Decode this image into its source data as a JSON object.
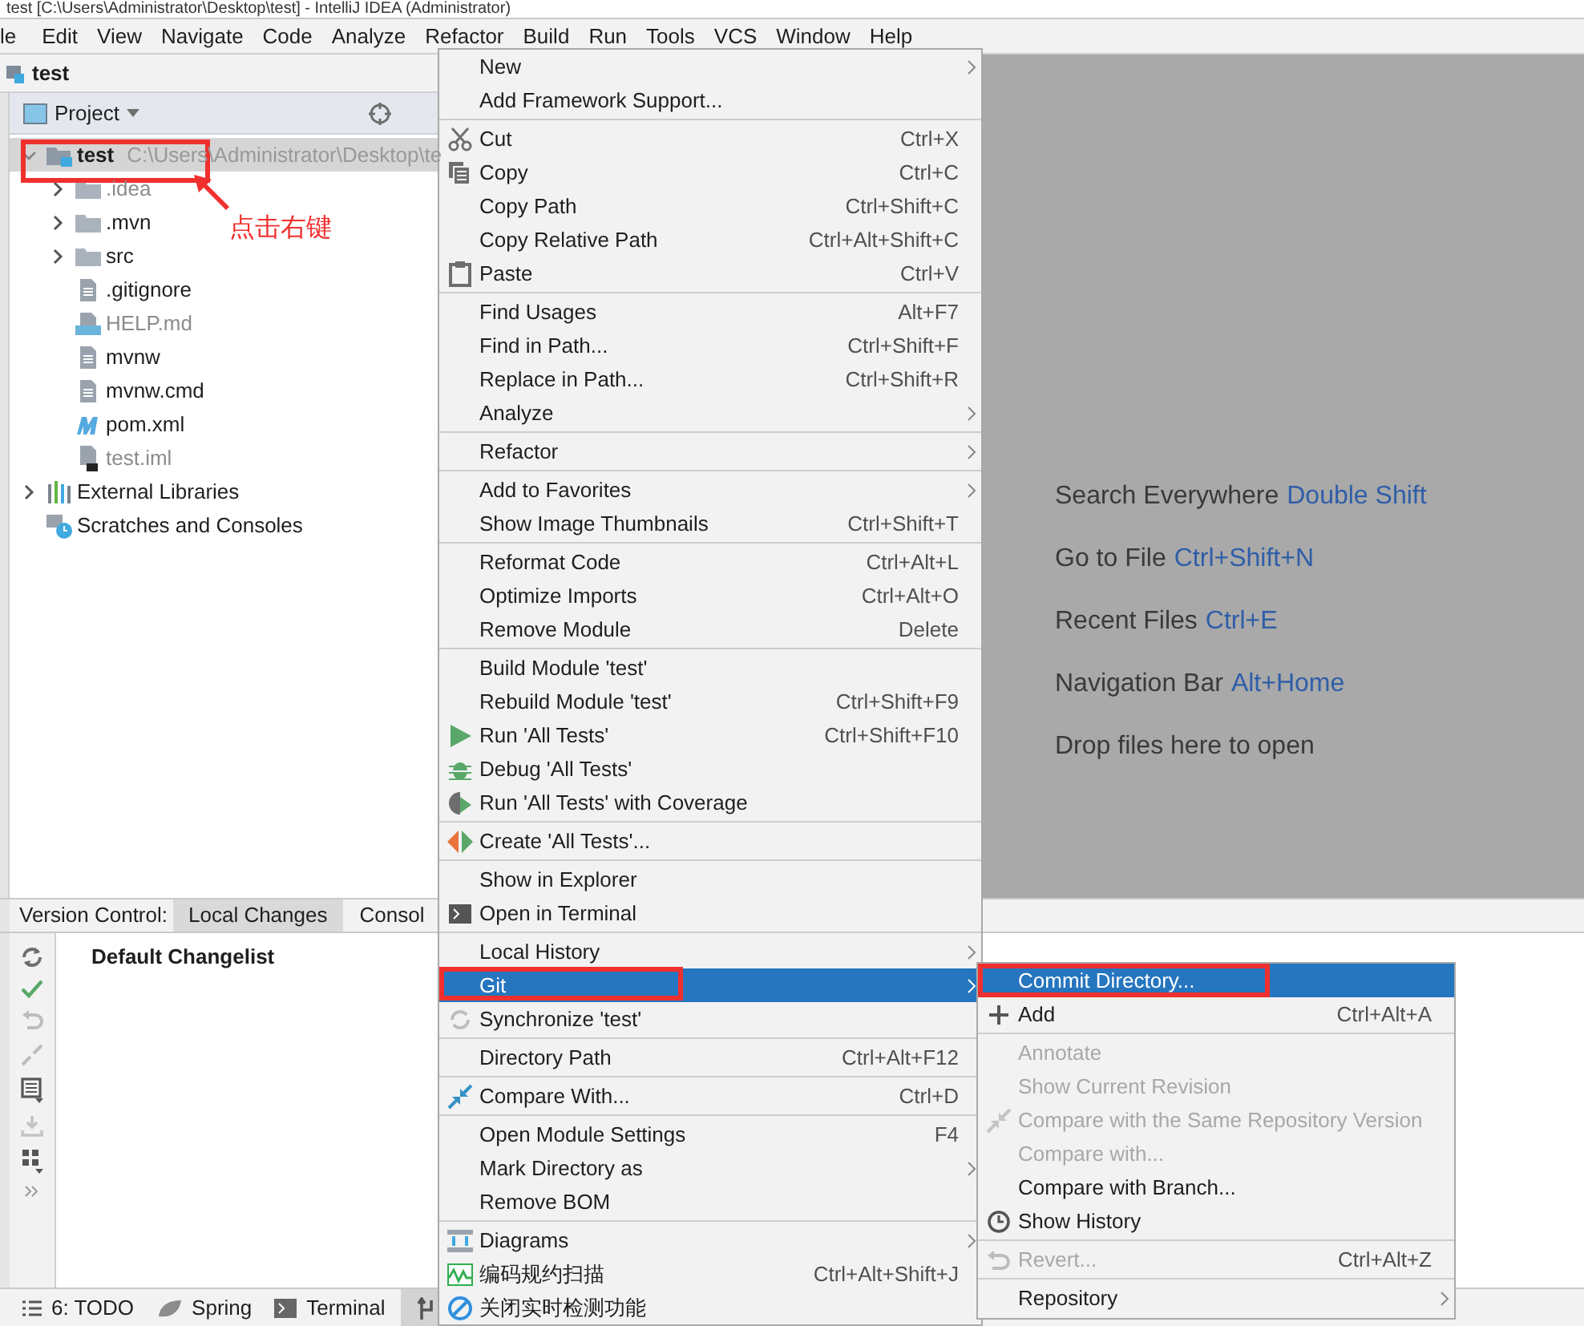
{
  "window": {
    "title": "test [C:\\Users\\Administrator\\Desktop\\test] - IntelliJ IDEA (Administrator)"
  },
  "menu_bar": [
    "le",
    "Edit",
    "View",
    "Navigate",
    "Code",
    "Analyze",
    "Refactor",
    "Build",
    "Run",
    "Tools",
    "VCS",
    "Window",
    "Help"
  ],
  "nav_bar": {
    "label": "test"
  },
  "project_panel": {
    "title": "Project",
    "tree": [
      {
        "label": "test",
        "path": "C:\\Users\\Administrator\\Desktop\\te",
        "kind": "module",
        "expanded": true,
        "selected": true,
        "children": [
          {
            "label": ".idea",
            "kind": "folder",
            "expanded": false,
            "selected": false,
            "ignored": true
          },
          {
            "label": ".mvn",
            "kind": "folder",
            "expanded": false,
            "selected": false,
            "ignored": false
          },
          {
            "label": "src",
            "kind": "folder",
            "expanded": false,
            "selected": false,
            "ignored": false
          },
          {
            "label": ".gitignore",
            "kind": "file",
            "selected": false,
            "ignored": false
          },
          {
            "label": "HELP.md",
            "kind": "markdown",
            "selected": false,
            "ignored": true
          },
          {
            "label": "mvnw",
            "kind": "file",
            "selected": false,
            "ignored": false
          },
          {
            "label": "mvnw.cmd",
            "kind": "file",
            "selected": false,
            "ignored": false
          },
          {
            "label": "pom.xml",
            "kind": "maven",
            "selected": false,
            "ignored": false
          },
          {
            "label": "test.iml",
            "kind": "iml",
            "selected": false,
            "ignored": true
          }
        ]
      },
      {
        "label": "External Libraries",
        "kind": "libraries",
        "expanded": false,
        "selected": false
      },
      {
        "label": "Scratches and Consoles",
        "kind": "scratches",
        "selected": false
      }
    ]
  },
  "editor_hints": [
    {
      "text": "Search Everywhere",
      "shortcut": "Double Shift"
    },
    {
      "text": "Go to File",
      "shortcut": "Ctrl+Shift+N"
    },
    {
      "text": "Recent Files",
      "shortcut": "Ctrl+E"
    },
    {
      "text": "Navigation Bar",
      "shortcut": "Alt+Home"
    },
    {
      "text": "Drop files here to open"
    }
  ],
  "version_control": {
    "label": "Version Control:",
    "tabs": [
      {
        "label": "Local Changes",
        "selected": true
      },
      {
        "label": "Consol",
        "selected": false
      }
    ],
    "changelist": "Default Changelist"
  },
  "status_bar": {
    "tabs": [
      {
        "label": "6: TODO",
        "kind": "todo",
        "selected": false
      },
      {
        "label": "Spring",
        "kind": "spring",
        "selected": false
      },
      {
        "label": "Terminal",
        "kind": "terminal",
        "selected": false
      },
      {
        "kind": "vcs",
        "selected": true
      }
    ]
  },
  "context_menu": {
    "groups": [
      [
        {
          "label": "New",
          "submenu": true,
          "selected": false
        },
        {
          "label": "Add Framework Support...",
          "selected": false
        }
      ],
      [
        {
          "label": "Cut",
          "kind": "cut",
          "shortcut": "Ctrl+X",
          "selected": false
        },
        {
          "label": "Copy",
          "kind": "copy",
          "shortcut": "Ctrl+C",
          "selected": false
        },
        {
          "label": "Copy Path",
          "shortcut": "Ctrl+Shift+C",
          "selected": false
        },
        {
          "label": "Copy Relative Path",
          "shortcut": "Ctrl+Alt+Shift+C",
          "selected": false
        },
        {
          "label": "Paste",
          "kind": "paste",
          "shortcut": "Ctrl+V",
          "selected": false
        }
      ],
      [
        {
          "label": "Find Usages",
          "shortcut": "Alt+F7",
          "selected": false
        },
        {
          "label": "Find in Path...",
          "shortcut": "Ctrl+Shift+F",
          "selected": false
        },
        {
          "label": "Replace in Path...",
          "shortcut": "Ctrl+Shift+R",
          "selected": false
        },
        {
          "label": "Analyze",
          "submenu": true,
          "selected": false
        }
      ],
      [
        {
          "label": "Refactor",
          "submenu": true,
          "selected": false
        }
      ],
      [
        {
          "label": "Add to Favorites",
          "submenu": true,
          "selected": false
        },
        {
          "label": "Show Image Thumbnails",
          "shortcut": "Ctrl+Shift+T",
          "selected": false
        }
      ],
      [
        {
          "label": "Reformat Code",
          "shortcut": "Ctrl+Alt+L",
          "selected": false
        },
        {
          "label": "Optimize Imports",
          "shortcut": "Ctrl+Alt+O",
          "selected": false
        },
        {
          "label": "Remove Module",
          "shortcut": "Delete",
          "selected": false
        }
      ],
      [
        {
          "label": "Build Module 'test'",
          "selected": false
        },
        {
          "label": "Rebuild Module 'test'",
          "shortcut": "Ctrl+Shift+F9",
          "selected": false
        },
        {
          "label": "Run 'All Tests'",
          "kind": "run",
          "shortcut": "Ctrl+Shift+F10",
          "selected": false
        },
        {
          "label": "Debug 'All Tests'",
          "kind": "debug",
          "selected": false
        },
        {
          "label": "Run 'All Tests' with Coverage",
          "kind": "coverage",
          "selected": false
        }
      ],
      [
        {
          "label": "Create 'All Tests'...",
          "kind": "create_test",
          "selected": false
        }
      ],
      [
        {
          "label": "Show in Explorer",
          "selected": false
        },
        {
          "label": "Open in Terminal",
          "kind": "terminal",
          "selected": false
        }
      ],
      [
        {
          "label": "Local History",
          "submenu": true,
          "selected": false
        },
        {
          "label": "Git",
          "submenu": true,
          "selected": true
        },
        {
          "label": "Synchronize 'test'",
          "kind": "sync",
          "selected": false
        }
      ],
      [
        {
          "label": "Directory Path",
          "shortcut": "Ctrl+Alt+F12",
          "selected": false
        }
      ],
      [
        {
          "label": "Compare With...",
          "kind": "compare",
          "shortcut": "Ctrl+D",
          "selected": false
        }
      ],
      [
        {
          "label": "Open Module Settings",
          "shortcut": "F4",
          "selected": false
        },
        {
          "label": "Mark Directory as",
          "submenu": true,
          "selected": false
        },
        {
          "label": "Remove BOM",
          "selected": false
        }
      ],
      [
        {
          "label": "Diagrams",
          "kind": "diagrams",
          "submenu": true,
          "selected": false
        },
        {
          "label": "编码规约扫描",
          "kind": "scan",
          "shortcut": "Ctrl+Alt+Shift+J",
          "selected": false
        },
        {
          "label": "关闭实时检测功能",
          "kind": "disable",
          "selected": false
        }
      ]
    ]
  },
  "git_submenu": {
    "groups": [
      [
        {
          "label": "Commit Directory...",
          "selected": true,
          "disabled": false
        },
        {
          "label": "Add",
          "kind": "add",
          "shortcut": "Ctrl+Alt+A",
          "selected": false,
          "disabled": false
        }
      ],
      [
        {
          "label": "Annotate",
          "selected": false,
          "disabled": true
        },
        {
          "label": "Show Current Revision",
          "selected": false,
          "disabled": true
        },
        {
          "label": "Compare with the Same Repository Version",
          "kind": "compare",
          "selected": false,
          "disabled": true
        },
        {
          "label": "Compare with...",
          "selected": false,
          "disabled": true
        },
        {
          "label": "Compare with Branch...",
          "selected": false,
          "disabled": false
        },
        {
          "label": "Show History",
          "kind": "history",
          "selected": false,
          "disabled": false
        }
      ],
      [
        {
          "label": "Revert...",
          "kind": "revert",
          "shortcut": "Ctrl+Alt+Z",
          "selected": false,
          "disabled": true
        }
      ],
      [
        {
          "label": "Repository",
          "submenu": true,
          "selected": false,
          "disabled": false
        }
      ]
    ]
  },
  "annotation": {
    "text": "点击右键"
  }
}
